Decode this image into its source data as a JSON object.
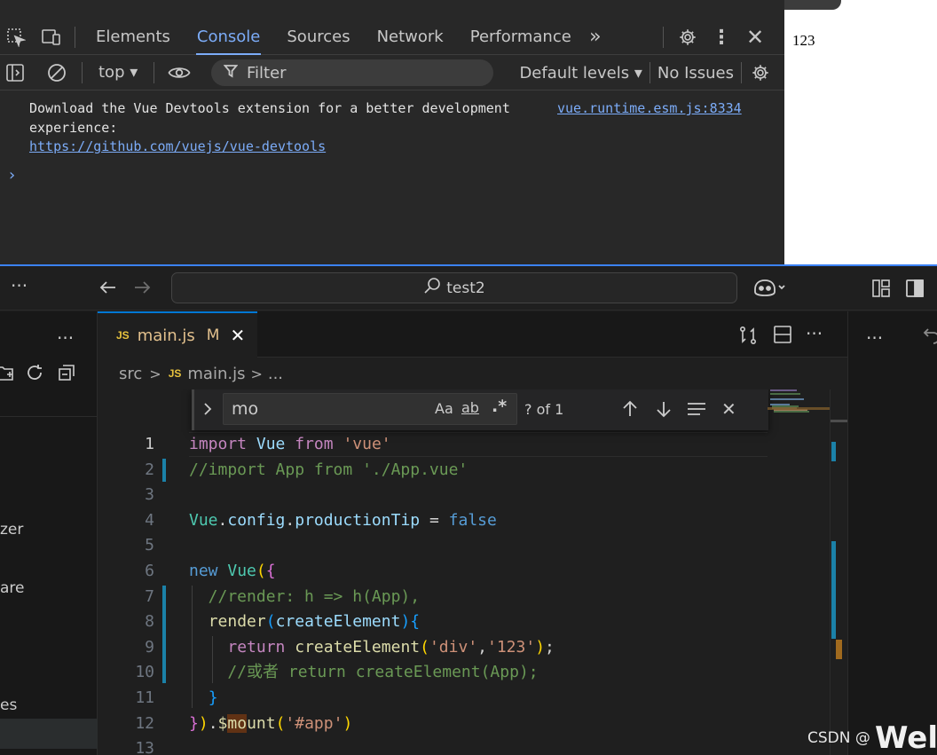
{
  "devtools": {
    "tabs": [
      "Elements",
      "Console",
      "Sources",
      "Network",
      "Performance"
    ],
    "active_tab": "Console",
    "toolbar": {
      "context": "top",
      "filter_placeholder": "Filter",
      "levels": "Default levels",
      "issues": "No Issues"
    },
    "console": {
      "message_line1": "Download the Vue Devtools extension for a better development",
      "message_line2": "experience:",
      "message_link": "https://github.com/vuejs/vue-devtools",
      "source": "vue.runtime.esm.js:8334",
      "prompt": "›"
    },
    "page_preview_text": "123"
  },
  "vscode": {
    "command_center": "test2",
    "sidebar_labels": [
      "zer",
      "are",
      "es"
    ],
    "tab": {
      "badge": "JS",
      "name": "main.js",
      "status": "M"
    },
    "breadcrumb": {
      "folder": "src",
      "badge": "JS",
      "file": "main.js",
      "more": "..."
    },
    "find": {
      "query": "mo",
      "match_case": "Aa",
      "whole_word": "ab",
      "regex": ".*",
      "count": "? of 1"
    },
    "line_numbers": [
      "1",
      "2",
      "3",
      "4",
      "5",
      "6",
      "7",
      "8",
      "9",
      "10",
      "11",
      "12",
      "13"
    ]
  },
  "watermark": {
    "prefix": "CSDN @",
    "suffix": "Welc"
  },
  "colors": {
    "accent": "#7cacf8",
    "vscode_blue": "#0078d4",
    "modified": "#1b81a8"
  }
}
